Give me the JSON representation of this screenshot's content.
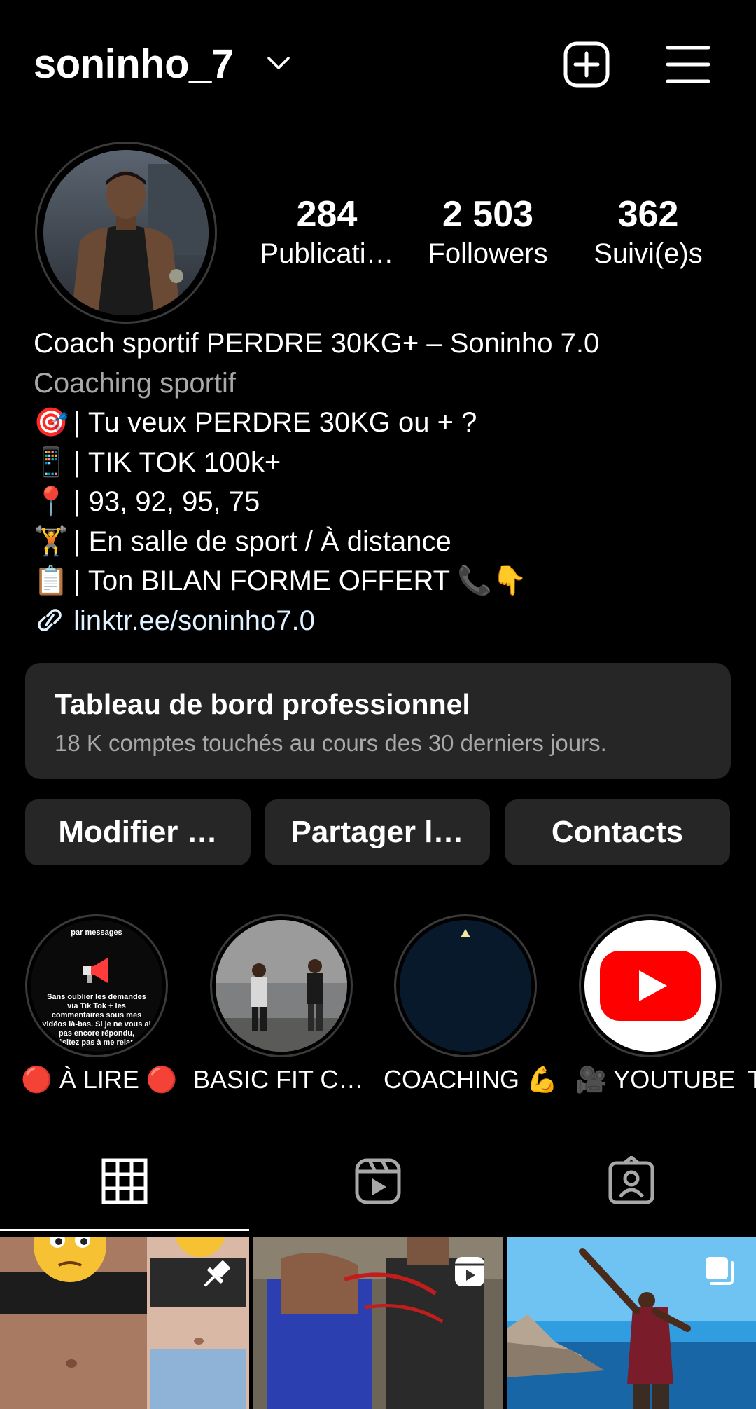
{
  "header": {
    "username": "soninho_7"
  },
  "profile": {
    "stats": [
      {
        "value": "284",
        "label": "Publicati…"
      },
      {
        "value": "2 503",
        "label": "Followers"
      },
      {
        "value": "362",
        "label": "Suivi(e)s"
      }
    ],
    "name": "Coach sportif PERDRE 30KG+ – Soninho 7.0",
    "category": "Coaching sportif",
    "bio_lines": [
      {
        "emoji": "🎯",
        "text": "| Tu veux PERDRE 30KG ou + ?"
      },
      {
        "emoji": "📱",
        "text": "| TIK TOK 100k+"
      },
      {
        "emoji": "📍",
        "text": "| 93, 92, 95, 75"
      },
      {
        "emoji": "🏋",
        "text": "| En salle de sport / À distance"
      },
      {
        "emoji": "📋",
        "text": "| Ton BILAN FORME OFFERT 📞👇"
      }
    ],
    "link": "linktr.ee/soninho7.0"
  },
  "dashboard": {
    "title": "Tableau de bord professionnel",
    "subtitle": "18 K comptes touchés au cours des 30 derniers jours."
  },
  "buttons": {
    "edit": "Modifier …",
    "share": "Partager l…",
    "contacts": "Contacts"
  },
  "highlights": [
    {
      "label": "🔴 À LIRE 🔴",
      "cover_text_top": "par messages",
      "cover_text": "Sans oublier les demandes via Tik Tok + les commentaires sous mes vidéos là-bas. Si je ne vous ai pas encore répondu, n'hésitez pas à me relancer"
    },
    {
      "label": "BASIC FIT C…"
    },
    {
      "label": "COACHING 💪"
    },
    {
      "label": "🎥 YOUTUBE"
    },
    {
      "label": "T"
    }
  ],
  "tabs": [
    "grid-icon",
    "reels-icon",
    "tagged-icon"
  ],
  "colors": {
    "background": "#000000",
    "surface": "#262626",
    "muted": "#a8a8a8",
    "youtube_red": "#ff0000"
  }
}
